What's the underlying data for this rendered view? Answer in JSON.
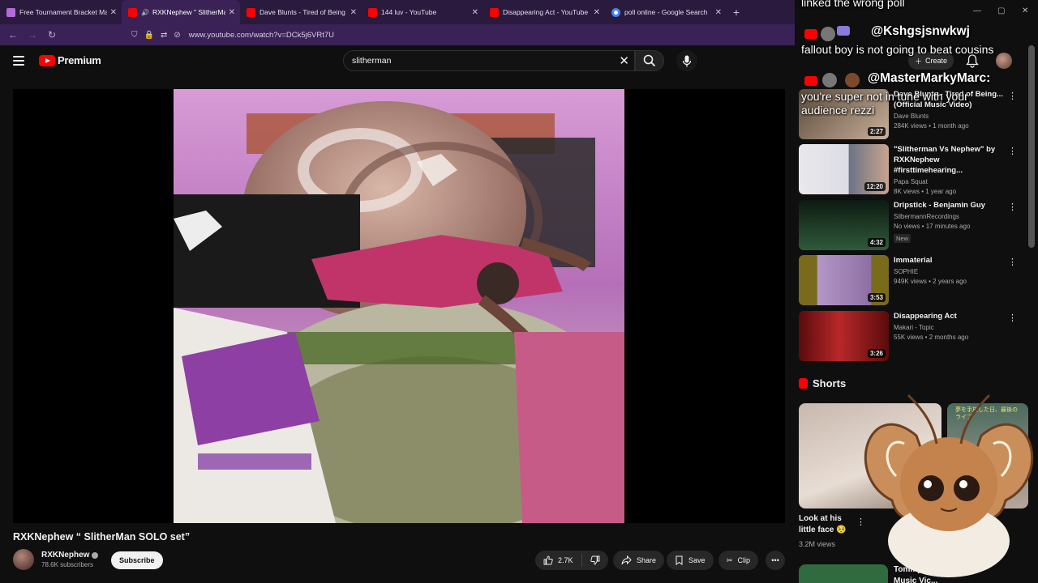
{
  "browser": {
    "tabs": [
      {
        "title": "Free Tournament Bracket Maker",
        "favicon_color": "#b36ad9",
        "active": false
      },
      {
        "title": "RXKNephew \" SlitherMan SOLO",
        "favicon_color": "#ff0000",
        "active": true
      },
      {
        "title": "Dave Blunts - Tired of Being Gr...",
        "favicon_color": "#ff0000",
        "active": false
      },
      {
        "title": "144 luv - YouTube",
        "favicon_color": "#ff0000",
        "active": false
      },
      {
        "title": "Disappearing Act - YouTube",
        "favicon_color": "#ff0000",
        "active": false
      },
      {
        "title": "poll online - Google Search",
        "favicon_color": "#4285f4",
        "active": false
      }
    ],
    "new_tab": "+",
    "url": "www.youtube.com/watch?v=DCk5j6VRt7U"
  },
  "header": {
    "brand": "Premium",
    "search_query": "slitherman",
    "create_label": "Create"
  },
  "video": {
    "title": "RXKNephew “ SlitherMan SOLO set”",
    "channel": "RXKNephew",
    "subscribers": "78.6K subscribers",
    "subscribe_label": "Subscribe",
    "likes": "2.7K",
    "share_label": "Share",
    "save_label": "Save",
    "clip_label": "Clip"
  },
  "chat_overlay": {
    "line1": "linked the wrong poll",
    "user1": "@Kshgsjsnwkwj",
    "line2": "fallout boy is not going to beat cousins",
    "user2": "@MasterMarkyMarc:",
    "line3": "you're super not in tune with your",
    "line4": "audience rezzi"
  },
  "recommendations": [
    {
      "title": "Dave Blunts - Tired of Being... (Official Music Video)",
      "channel": "Dave Blunts",
      "verified": true,
      "stats": "284K views • 1 month ago",
      "duration": "2:27",
      "badge": ""
    },
    {
      "title": "\"Slitherman Vs Nephew\" by RXKNephew #firsttimehearing...",
      "channel": "Papa Squat",
      "verified": false,
      "stats": "8K views • 1 year ago",
      "duration": "12:20",
      "badge": ""
    },
    {
      "title": "Dripstick - Benjamin Guy",
      "channel": "SilbermannRecordings",
      "verified": false,
      "stats": "No views • 17 minutes ago",
      "duration": "4:32",
      "badge": "New"
    },
    {
      "title": "Immaterial",
      "channel": "SOPHIE",
      "verified": true,
      "stats": "949K views • 2 years ago",
      "duration": "3:53",
      "badge": ""
    },
    {
      "title": "Disappearing Act",
      "channel": "Makari - Topic",
      "verified": false,
      "stats": "55K views • 2 months ago",
      "duration": "3:26",
      "badge": ""
    }
  ],
  "shorts": {
    "heading": "Shorts",
    "items": [
      {
        "title": "Look at his little face 🥺",
        "views": "3.2M views"
      },
      {
        "title": "Tommy W... Music Vic...",
        "views": ""
      }
    ],
    "overlay_text": "夢を手放した日、最後のライブ"
  }
}
